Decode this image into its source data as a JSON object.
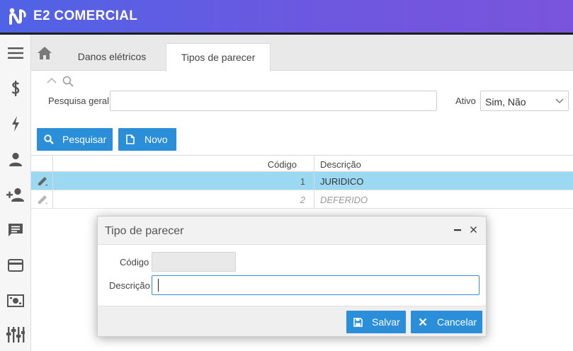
{
  "header": {
    "brand": "E2 COMERCIAL",
    "accent": "#5b5fe4",
    "border": "#1e1e1e"
  },
  "sidebar": {
    "items": [
      {
        "icon": "menu-icon"
      },
      {
        "icon": "dollar-icon"
      },
      {
        "icon": "lightning-icon"
      },
      {
        "icon": "person-icon"
      },
      {
        "icon": "person-add-icon"
      },
      {
        "icon": "message-icon"
      },
      {
        "icon": "credit-card-icon"
      },
      {
        "icon": "money-icon"
      },
      {
        "icon": "equalizer-icon"
      }
    ]
  },
  "tabs": [
    {
      "label": "Danos elétricos",
      "active": false
    },
    {
      "label": "Tipos de parecer",
      "active": true
    }
  ],
  "search": {
    "label": "Pesquisa geral",
    "value": "",
    "ativo_label": "Ativo",
    "ativo_value": "Sim, Não"
  },
  "actions": {
    "search_label": "Pesquisar",
    "new_label": "Novo",
    "button_color": "#2a8fd8"
  },
  "grid": {
    "columns": [
      "Código",
      "Descrição"
    ],
    "rows": [
      {
        "code": "1",
        "description": "JURIDICO",
        "selected": true,
        "active": true
      },
      {
        "code": "2",
        "description": "DEFERIDO",
        "selected": false,
        "active": false
      }
    ],
    "selected_color": "#9bd9f3"
  },
  "dialog": {
    "title": "Tipo de parecer",
    "code_label": "Código",
    "code_value": "",
    "description_label": "Descrição",
    "description_value": "",
    "save_label": "Salvar",
    "cancel_label": "Cancelar"
  }
}
